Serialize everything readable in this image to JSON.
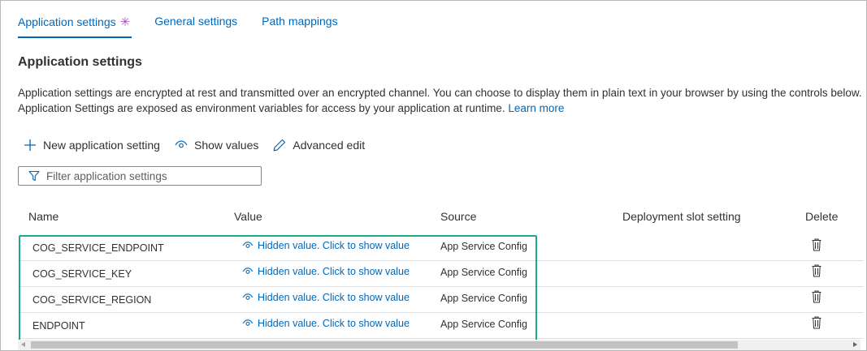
{
  "tabs": [
    {
      "label": "Application settings",
      "active": true,
      "modified_marker": "✳"
    },
    {
      "label": "General settings",
      "active": false
    },
    {
      "label": "Path mappings",
      "active": false
    }
  ],
  "section": {
    "title": "Application settings",
    "description": "Application settings are encrypted at rest and transmitted over an encrypted channel. You can choose to display them in plain text in your browser by using the controls below. Application Settings are exposed as environment variables for access by your application at runtime.",
    "learn_more": "Learn more"
  },
  "toolbar": {
    "new_setting": "New application setting",
    "show_values": "Show values",
    "advanced_edit": "Advanced edit"
  },
  "filter": {
    "placeholder": "Filter application settings",
    "value": ""
  },
  "table": {
    "headers": {
      "name": "Name",
      "value": "Value",
      "source": "Source",
      "slot": "Deployment slot setting",
      "delete": "Delete"
    },
    "rows": [
      {
        "name": "COG_SERVICE_ENDPOINT",
        "value": "Hidden value. Click to show value",
        "source": "App Service Config"
      },
      {
        "name": "COG_SERVICE_KEY",
        "value": "Hidden value. Click to show value",
        "source": "App Service Config"
      },
      {
        "name": "COG_SERVICE_REGION",
        "value": "Hidden value. Click to show value",
        "source": "App Service Config"
      },
      {
        "name": "ENDPOINT",
        "value": "Hidden value. Click to show value",
        "source": "App Service Config"
      }
    ]
  },
  "colors": {
    "accent": "#0067b8",
    "highlight": "#1aab8b",
    "modified": "#a04ebf"
  }
}
